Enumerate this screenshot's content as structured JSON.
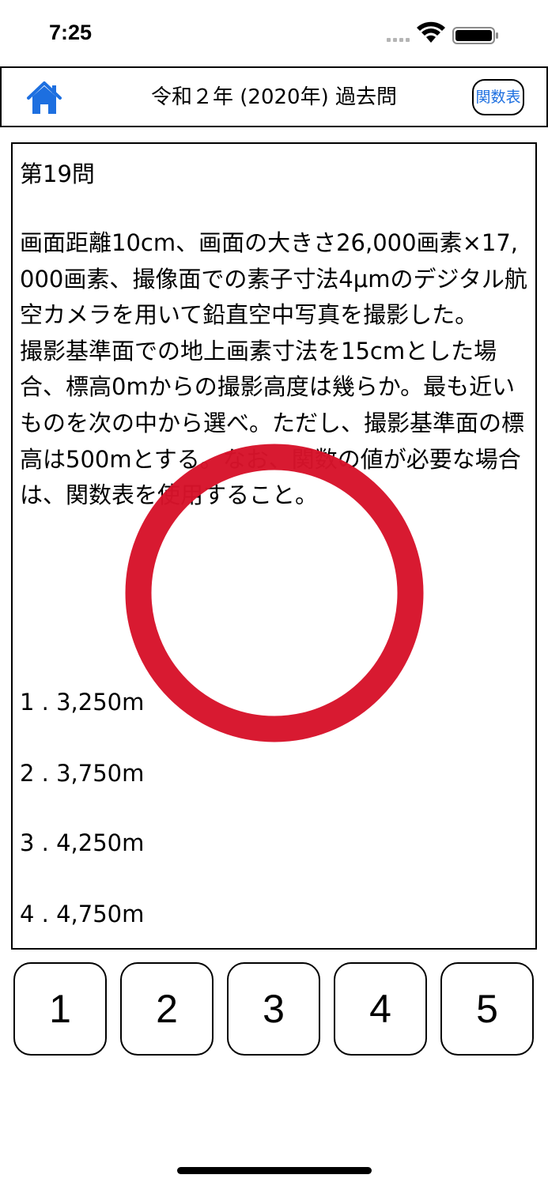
{
  "status_bar": {
    "time": "7:25",
    "icons": [
      "signal-icon",
      "wifi-icon",
      "battery-icon"
    ]
  },
  "nav_bar": {
    "home_icon": "home-icon",
    "title": "令和２年 (2020年) 過去問",
    "function_table_button": "関数表"
  },
  "question": {
    "number": "第19問",
    "text": "画面距離10cm、画面の大きさ26,000画素×17,000画素、撮像面での素子寸法4μmのデジタル航空カメラを用いて鉛直空中写真を撮影した。\n撮影基準面での地上画素寸法を15cmとした場合、標高0mからの撮影高度は幾らか。最も近いものを次の中から選べ。ただし、撮影基準面の標高は500mとする。なお、関数の値が必要な場合は、関数表を使用すること。",
    "choices": [
      "1 . 3,250m",
      "2 . 3,750m",
      "3 . 4,250m",
      "4 . 4,750m"
    ]
  },
  "result": {
    "mark": "correct-circle",
    "color": "#d7132a"
  },
  "answer_buttons": [
    "1",
    "2",
    "3",
    "4",
    "5"
  ],
  "colors": {
    "accent": "#1d6fe0",
    "correct": "#d7132a",
    "border": "#000000"
  }
}
